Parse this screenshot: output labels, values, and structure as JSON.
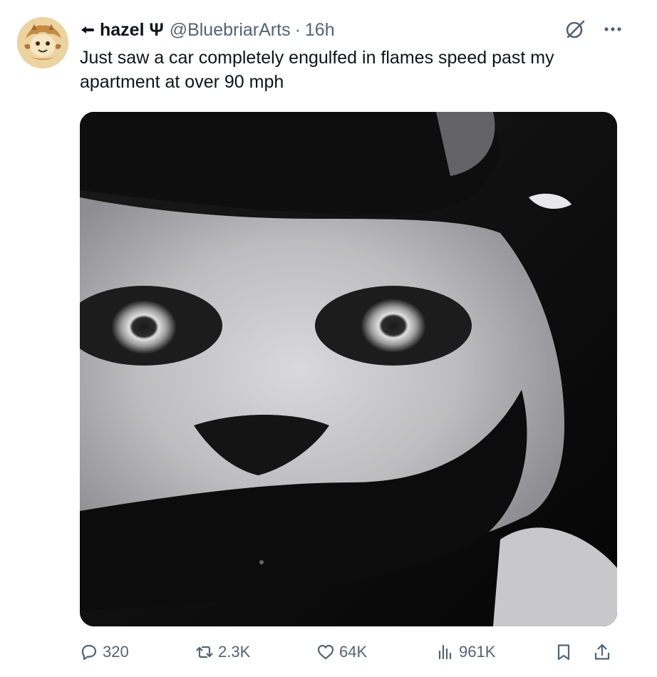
{
  "tweet": {
    "author": {
      "display_name": "hazel Ψ",
      "handle": "@BluebriarArts",
      "separator": "·",
      "time": "16h",
      "name_prefix_icon": "pointing-hand-icon"
    },
    "text": "Just saw a car completely engulfed in flames speed past my apartment at over 90 mph",
    "media": {
      "description_icon": "wide-eyed-cat-photo"
    },
    "actions": {
      "replies": "320",
      "reposts": "2.3K",
      "likes": "64K",
      "views": "961K"
    }
  },
  "icons": {
    "grok": "grok-icon",
    "more": "more-icon",
    "reply": "reply-icon",
    "repost": "repost-icon",
    "like": "heart-icon",
    "views": "views-icon",
    "bookmark": "bookmark-icon",
    "share": "share-icon"
  },
  "colors": {
    "text_primary": "#0f1419",
    "text_secondary": "#536471",
    "background": "#ffffff"
  }
}
